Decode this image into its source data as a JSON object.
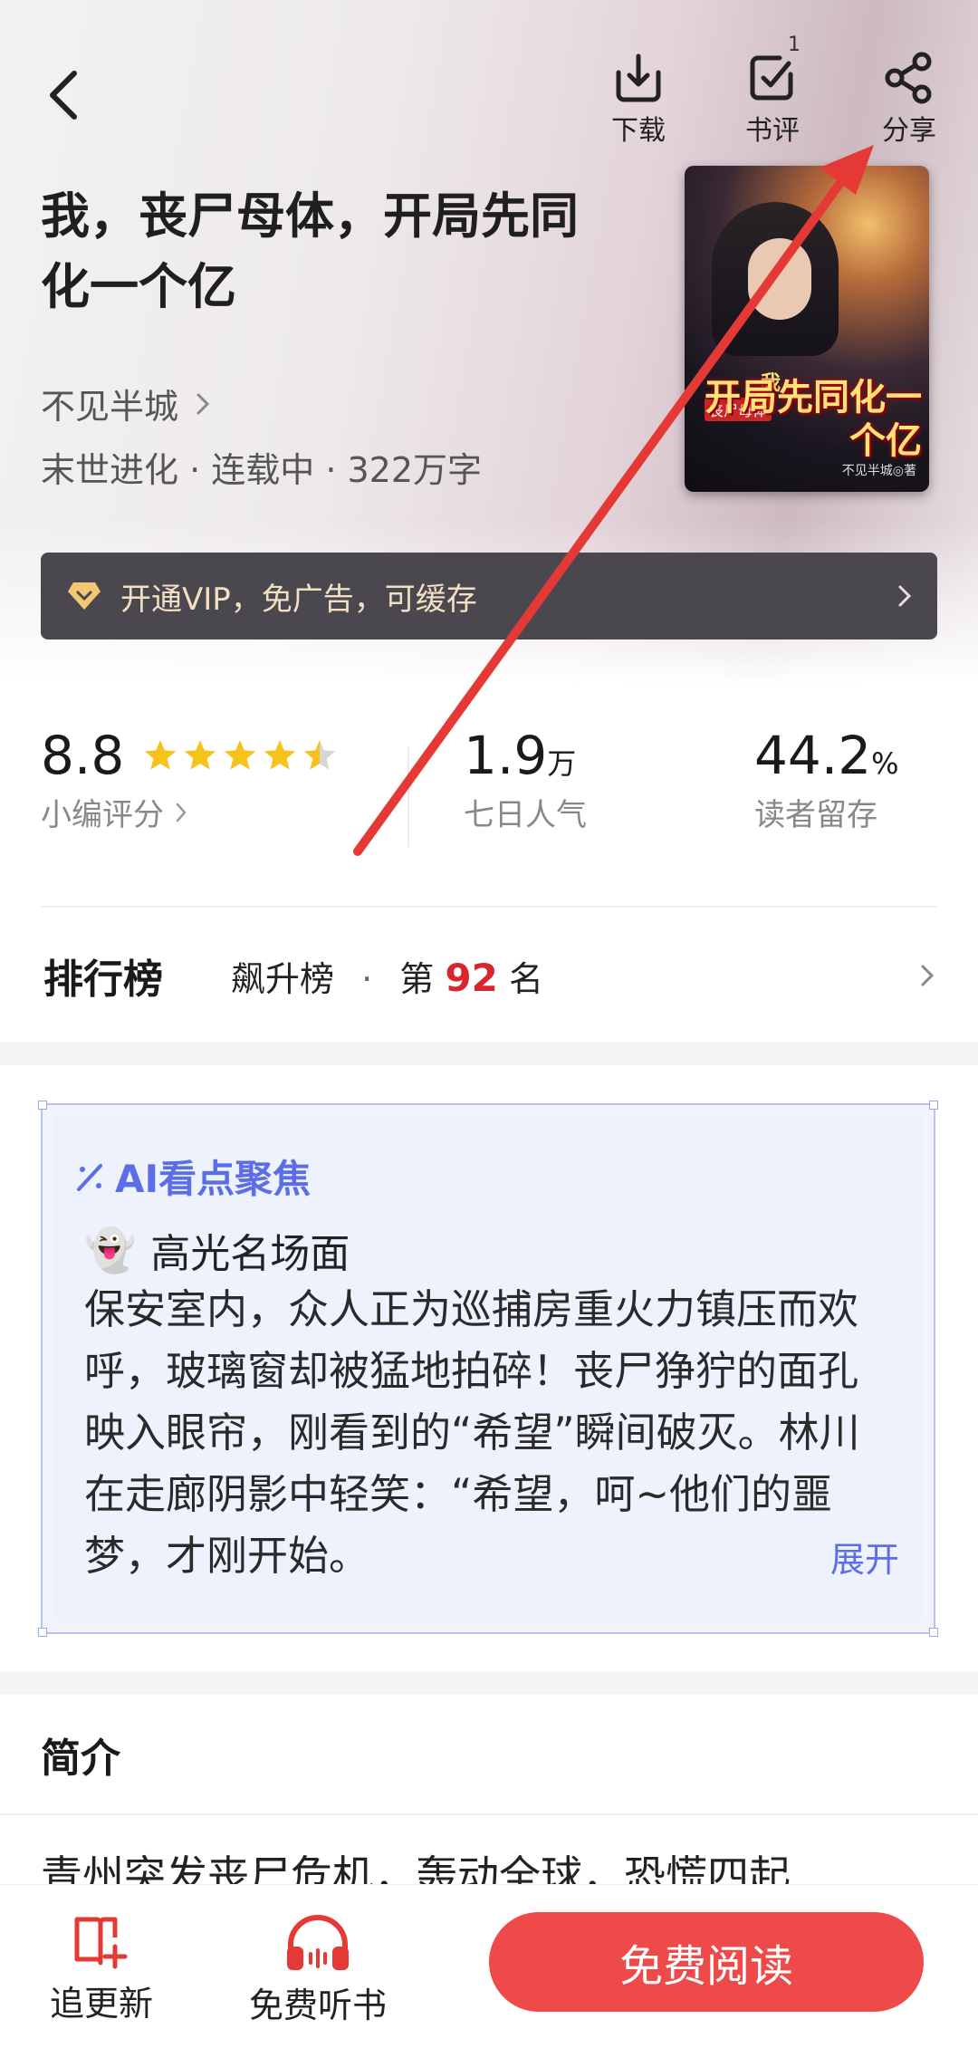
{
  "header": {
    "download_label": "下载",
    "review_label": "书评",
    "review_badge": "1",
    "share_label": "分享"
  },
  "book": {
    "title": "我，丧尸母体，开局先同化一个亿",
    "author": "不见半城",
    "meta": "末世进化 · 连载中 · 322万字",
    "cover": {
      "small_top": "我",
      "tag": "丧尸母体",
      "main": "开局先同化一个亿",
      "author_line": "不见半城◎著"
    }
  },
  "vip": {
    "label": "开通VIP，免广告，可缓存"
  },
  "stats": {
    "rating": {
      "value": "8.8",
      "stars": 4.5,
      "label": "小编评分"
    },
    "popularity": {
      "value": "1.9",
      "unit": "万",
      "label": "七日人气"
    },
    "retention": {
      "value": "44.2",
      "unit": "%",
      "label": "读者留存"
    }
  },
  "ranking": {
    "title": "排行榜",
    "list_name": "飙升榜",
    "sep": "·",
    "prefix": "第",
    "rank": "92",
    "suffix": "名"
  },
  "ai_focus": {
    "title": "AI看点聚焦",
    "subtitle": "高光名场面",
    "body": "保安室内，众人正为巡捕房重火力镇压而欢呼，玻璃窗却被猛地拍碎！丧尸狰狞的面孔映入眼帘，刚看到的“希望”瞬间破灭。林川在走廊阴影中轻笑：“希望，呵~他们的噩梦，才刚开始。",
    "expand_label": "展开"
  },
  "intro": {
    "title": "简介",
    "text": "青州突发丧尸危机，轰动全球，恐慌四起"
  },
  "bottom": {
    "follow_label": "追更新",
    "listen_label": "免费听书",
    "read_label": "免费阅读"
  },
  "colors": {
    "accent_red": "#ee4a4a",
    "rank_red": "#d7262d",
    "ai_blue": "#5b6ee8",
    "star_yellow": "#f6c21c"
  }
}
